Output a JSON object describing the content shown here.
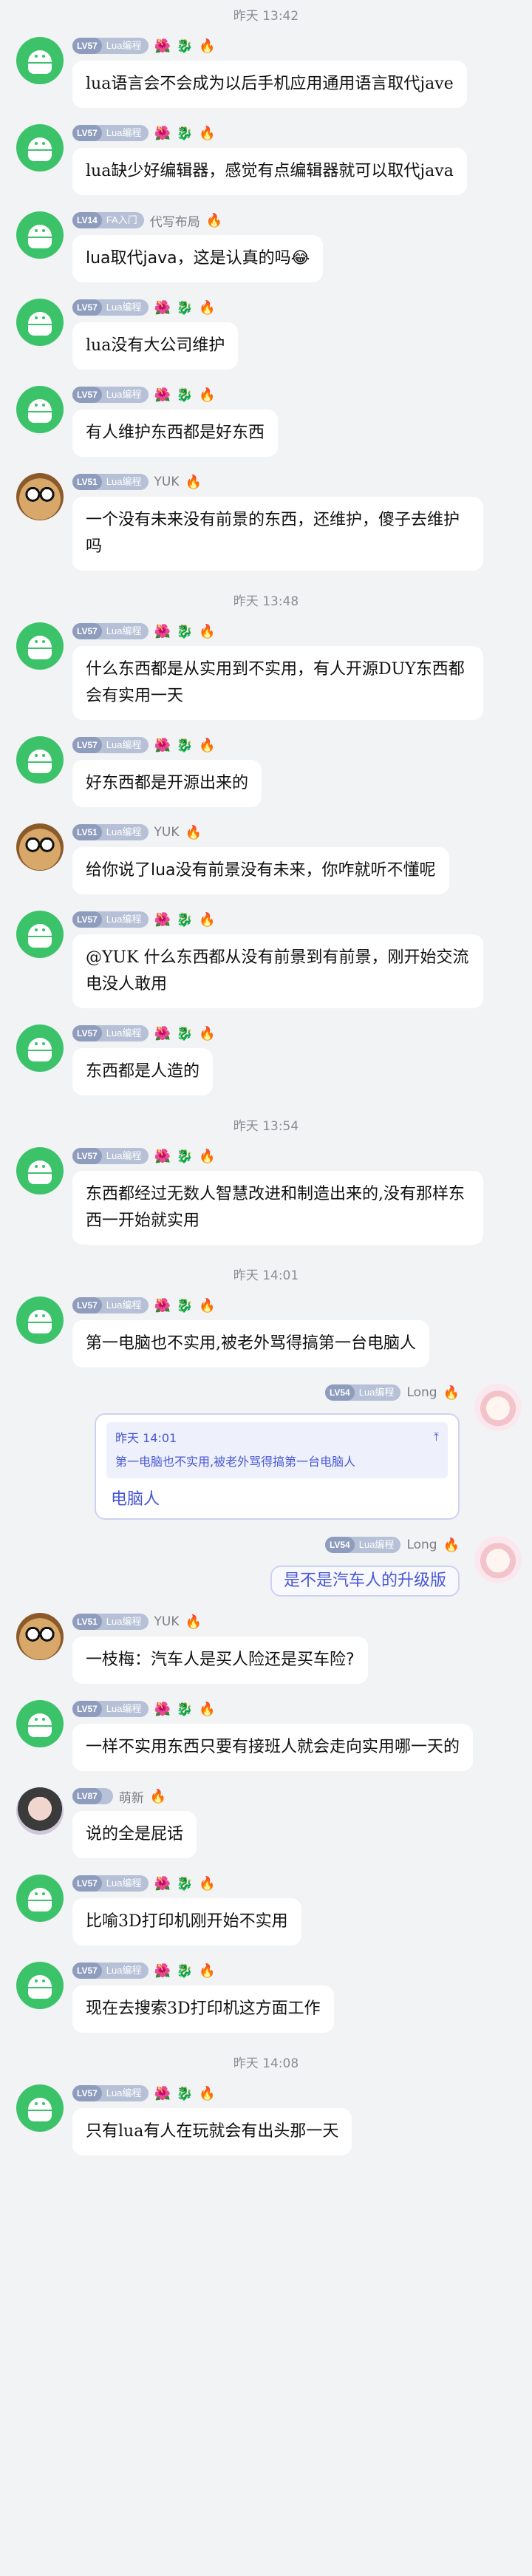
{
  "timestamps": {
    "t1": "昨天 13:42",
    "t2": "昨天 13:48",
    "t3": "昨天 13:54",
    "t4": "昨天 14:01",
    "t5": "昨天 14:08"
  },
  "badges": {
    "lv57": "LV57",
    "lv51": "LV51",
    "lv14": "LV14",
    "lv54": "LV54",
    "lv87": "LV87",
    "lua_title": "Lua编程",
    "fa_title": "FA入门"
  },
  "users": {
    "lua": "",
    "yuk": "YUK",
    "daima": "代写布局",
    "long": "Long",
    "mengxin": "萌新"
  },
  "messages": [
    {
      "text": "lua语言会不会成为以后手机应用通用语言取代jave"
    },
    {
      "text": "lua缺少好编辑器，感觉有点编辑器就可以取代java"
    },
    {
      "text": "lua取代java，这是认真的吗😂"
    },
    {
      "text": "lua没有大公司维护"
    },
    {
      "text": "有人维护东西都是好东西"
    },
    {
      "text": "一个没有未来没有前景的东西，还维护，傻子去维护吗"
    },
    {
      "text": "什么东西都是从实用到不实用，有人开源DUY东西都会有实用一天"
    },
    {
      "text": "好东西都是开源出来的"
    },
    {
      "text": "给你说了lua没有前景没有未来，你咋就听不懂呢"
    },
    {
      "text": "@YUK 什么东西都从没有前景到有前景，刚开始交流电没人敢用"
    },
    {
      "text": "东西都是人造的"
    },
    {
      "text": "东西都经过无数人智慧改进和制造出来的,没有那样东西一开始就实用"
    },
    {
      "text": "第一电脑也不实用,被老外骂得搞第一台电脑人"
    },
    {
      "quote_author": "昨天 14:01",
      "quote_text": "第一电脑也不实用,被老外骂得搞第一台电脑人",
      "text": "电脑人"
    },
    {
      "text": "是不是汽车人的升级版"
    },
    {
      "text": "一枝梅：汽车人是买人险还是买车险?"
    },
    {
      "text": "一样不实用东西只要有接班人就会走向实用哪一天的"
    },
    {
      "text": "说的全是屁话"
    },
    {
      "text": "比喻3D打印机刚开始不实用"
    },
    {
      "text": "现在去搜索3D打印机这方面工作"
    },
    {
      "text": "只有lua有人在玩就会有出头那一天"
    }
  ],
  "icons": {
    "android": "android-avatar-icon",
    "owl": "owl-avatar-icon",
    "person": "person-avatar-icon",
    "anime": "anime-avatar-icon",
    "flower": "🌺",
    "dragon": "🐉",
    "fire": "🔥"
  }
}
